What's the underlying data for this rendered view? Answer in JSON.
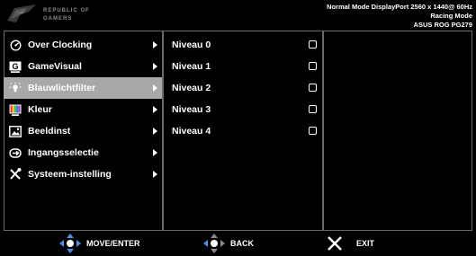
{
  "header": {
    "logo_line1": "REPUBLIC OF",
    "logo_line2": "GAMERS",
    "status_line1": "Normal Mode DisplayPort 2560 x 1440@ 60Hz",
    "status_line2": "Racing Mode",
    "status_line3": "ASUS ROG PG279"
  },
  "menu": {
    "items": [
      {
        "label": "Over Clocking",
        "icon": "overclock-icon"
      },
      {
        "label": "GameVisual",
        "icon": "gamevisual-icon"
      },
      {
        "label": "Blauwlichtfilter",
        "icon": "bluelight-icon",
        "selected": true
      },
      {
        "label": "Kleur",
        "icon": "color-icon"
      },
      {
        "label": "Beeldinst",
        "icon": "image-icon"
      },
      {
        "label": "Ingangsselectie",
        "icon": "input-icon"
      },
      {
        "label": "Systeem-instelling",
        "icon": "system-icon"
      }
    ]
  },
  "submenu": {
    "items": [
      {
        "label": "Niveau 0"
      },
      {
        "label": "Niveau 1"
      },
      {
        "label": "Niveau 2"
      },
      {
        "label": "Niveau 3"
      },
      {
        "label": "Niveau 4"
      }
    ]
  },
  "footer": {
    "move_label": "MOVE/ENTER",
    "back_label": "BACK",
    "exit_label": "EXIT"
  },
  "colors": {
    "accent_blue": "#4f8fe6",
    "selected_bg": "#a8a8a8",
    "frame": "#6a6a6a"
  }
}
